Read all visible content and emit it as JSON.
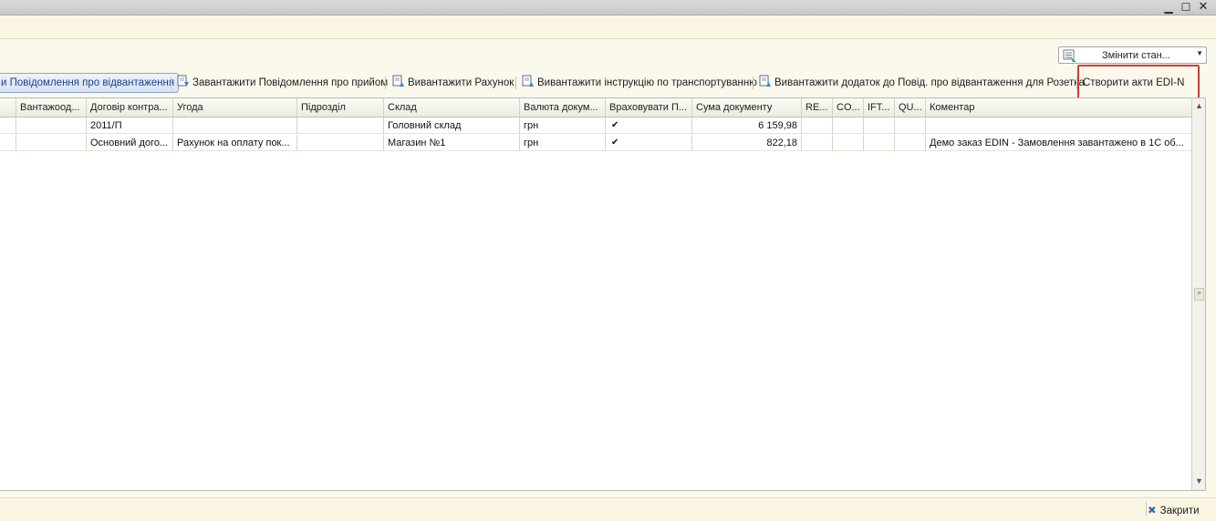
{
  "window": {
    "min": "▁",
    "max": "☐",
    "close": "✕"
  },
  "state_select": {
    "label": "Змінити стан...",
    "icon": "state-list-icon"
  },
  "toolbar": {
    "btn_shipment_notice": "и Повідомлення про відвантаження",
    "btn_load_receipt": "Завантажити Повідомлення про прийом",
    "btn_upload_invoice": "Вивантажити Рахунок",
    "btn_upload_transport": "Вивантажити інструкцію по транспортуванню",
    "btn_upload_rozetka": "Вивантажити додаток до Повід. про відвантаження для Розетка",
    "btn_create_acts": "Створити акти EDI-N"
  },
  "grid": {
    "columns": [
      "Вантажоод...",
      "Договір контра...",
      "Угода",
      "Підрозділ",
      "Склад",
      "Валюта докум...",
      "Враховувати П...",
      "Сума документу",
      "RE...",
      "CO...",
      "IFT...",
      "QU...",
      "Коментар"
    ],
    "rows": [
      {
        "vantaj": "",
        "dogovir": "2011/П",
        "ugoda": "",
        "pidrozdil": "",
        "sklad": "Головний склад",
        "valuta": "грн",
        "vrah": "✔",
        "suma": "6 159,98",
        "re": "",
        "co": "",
        "ift": "",
        "qu": "",
        "komentar": ""
      },
      {
        "vantaj": "",
        "dogovir": "Основний дого...",
        "ugoda": "Рахунок на оплату пок...",
        "pidrozdil": "",
        "sklad": "Магазин №1",
        "valuta": "грн",
        "vrah": "✔",
        "suma": "822,18",
        "re": "",
        "co": "",
        "ift": "",
        "qu": "",
        "komentar": "Демо заказ EDIN - Замовлення завантажено в 1С об..."
      }
    ]
  },
  "footer": {
    "close_label": "Закрити",
    "close_icon": "✖"
  },
  "colors": {
    "highlight": "#d23a3a",
    "background": "#fbf9ec"
  }
}
